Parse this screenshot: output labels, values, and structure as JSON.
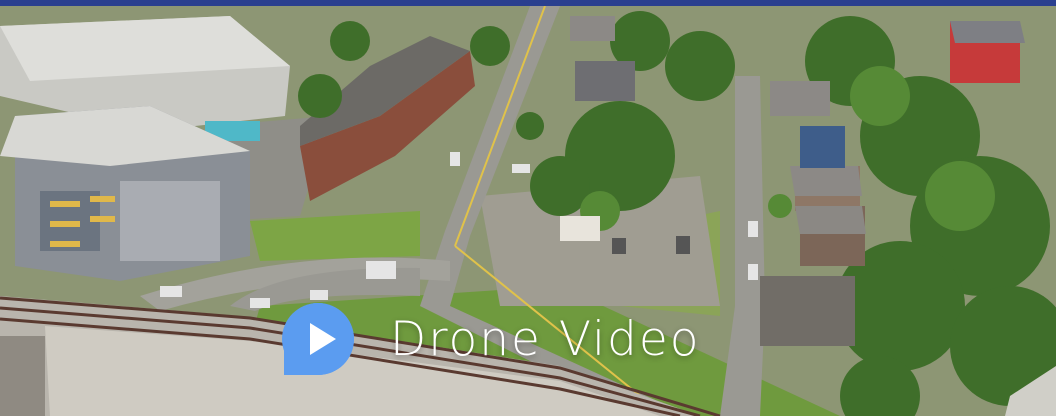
{
  "video_cta": {
    "label": "Drone Video",
    "icon": "play-icon"
  },
  "colors": {
    "top_bar": "#2a3f8f",
    "play_bubble": "#5b9cf0",
    "play_triangle": "#ffffff",
    "label": "#ffffff"
  }
}
